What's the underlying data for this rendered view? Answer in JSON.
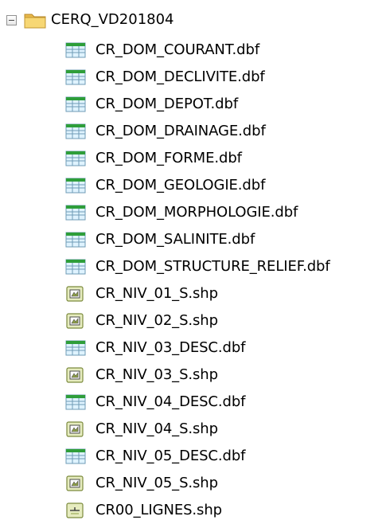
{
  "tree": {
    "root": {
      "label": "CERQ_VD201804",
      "expander_symbol": "−",
      "icon": "folder-icon"
    },
    "children": [
      {
        "label": "CR_DOM_COURANT.dbf",
        "icon": "table-icon"
      },
      {
        "label": "CR_DOM_DECLIVITE.dbf",
        "icon": "table-icon"
      },
      {
        "label": "CR_DOM_DEPOT.dbf",
        "icon": "table-icon"
      },
      {
        "label": "CR_DOM_DRAINAGE.dbf",
        "icon": "table-icon"
      },
      {
        "label": "CR_DOM_FORME.dbf",
        "icon": "table-icon"
      },
      {
        "label": "CR_DOM_GEOLOGIE.dbf",
        "icon": "table-icon"
      },
      {
        "label": "CR_DOM_MORPHOLOGIE.dbf",
        "icon": "table-icon"
      },
      {
        "label": "CR_DOM_SALINITE.dbf",
        "icon": "table-icon"
      },
      {
        "label": "CR_DOM_STRUCTURE_RELIEF.dbf",
        "icon": "table-icon"
      },
      {
        "label": "CR_NIV_01_S.shp",
        "icon": "polygon-feature-icon"
      },
      {
        "label": "CR_NIV_02_S.shp",
        "icon": "polygon-feature-icon"
      },
      {
        "label": "CR_NIV_03_DESC.dbf",
        "icon": "table-icon"
      },
      {
        "label": "CR_NIV_03_S.shp",
        "icon": "polygon-feature-icon"
      },
      {
        "label": "CR_NIV_04_DESC.dbf",
        "icon": "table-icon"
      },
      {
        "label": "CR_NIV_04_S.shp",
        "icon": "polygon-feature-icon"
      },
      {
        "label": "CR_NIV_05_DESC.dbf",
        "icon": "table-icon"
      },
      {
        "label": "CR_NIV_05_S.shp",
        "icon": "polygon-feature-icon"
      },
      {
        "label": "CR00_LIGNES.shp",
        "icon": "line-feature-icon"
      }
    ],
    "colors": {
      "table_header": "#2e9e3a",
      "table_body": "#dff3ff",
      "table_border": "#6f9bb5",
      "polygon_fill": "#e6ecbf",
      "polygon_border": "#7b8a3c",
      "folder": "#f5d365"
    }
  }
}
